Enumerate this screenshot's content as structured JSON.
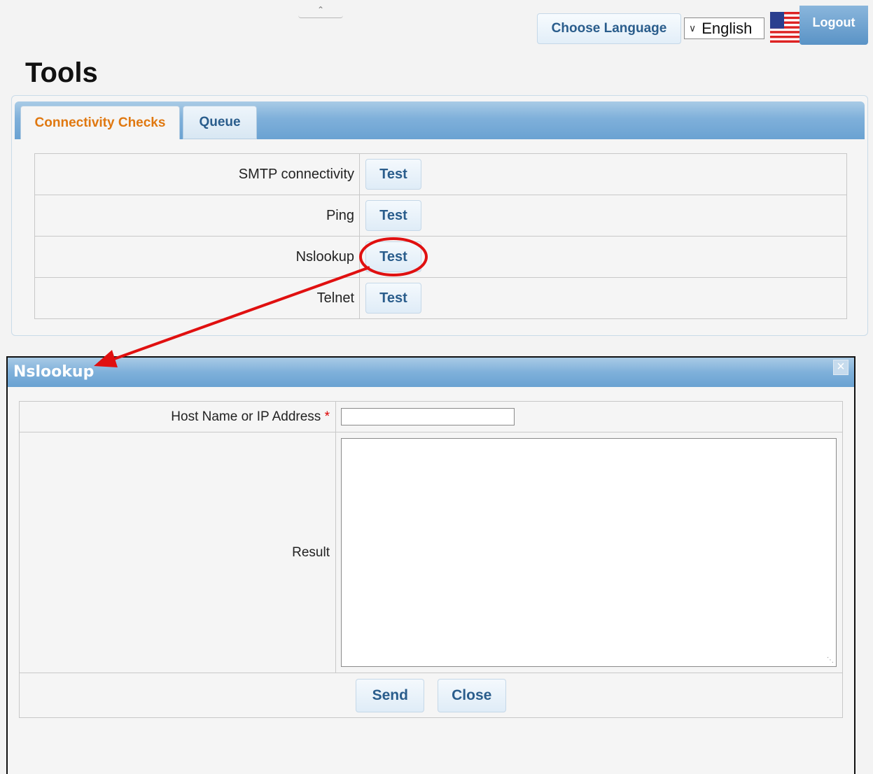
{
  "header": {
    "choose_language_label": "Choose Language",
    "language_selected": "English",
    "logout_label": "Logout"
  },
  "page": {
    "title": "Tools"
  },
  "tabs": [
    {
      "label": "Connectivity Checks",
      "active": true
    },
    {
      "label": "Queue",
      "active": false
    }
  ],
  "checks": [
    {
      "label": "SMTP connectivity",
      "button": "Test"
    },
    {
      "label": "Ping",
      "button": "Test"
    },
    {
      "label": "Nslookup",
      "button": "Test"
    },
    {
      "label": "Telnet",
      "button": "Test"
    }
  ],
  "dialog": {
    "title": "Nslookup",
    "host_label": "Host Name or IP Address",
    "required_mark": "*",
    "host_value": "",
    "result_label": "Result",
    "result_value": "",
    "send_label": "Send",
    "close_label": "Close"
  },
  "icons": {
    "collapse": "chevron-up-icon",
    "flag": "us-flag-icon",
    "close": "close-icon"
  },
  "colors": {
    "accent_blue": "#6aa2d2",
    "button_text": "#2a5d8c",
    "active_tab_text": "#e07810",
    "annotation_red": "#e01010"
  }
}
